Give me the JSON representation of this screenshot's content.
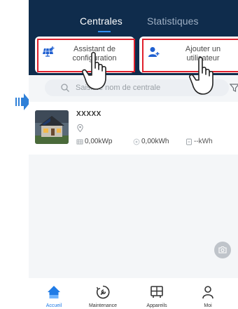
{
  "tabs": {
    "active": "Centrales",
    "inactive": "Statistiques"
  },
  "actions": {
    "assistant": {
      "line1": "Assistant de",
      "line2": "configuration"
    },
    "add_user": {
      "line1": "Ajouter un",
      "line2": "utilisateur"
    }
  },
  "search": {
    "placeholder": "Saisir le nom de centrale"
  },
  "plant": {
    "name": "XXXXX",
    "power": "0,00kWp",
    "energy": "0,00kWh",
    "daily": "--kWh"
  },
  "bottom_nav": {
    "accueil": "Accueil",
    "maintenance": "Maintenance",
    "appareils": "Appareils",
    "moi": "Moi"
  },
  "colors": {
    "header": "#0f2c4c",
    "accent": "#1f7be6",
    "highlight": "#e0202c",
    "arrow": "#2f80d8"
  },
  "icons": [
    "right-arrow-icon",
    "solar-panel-plus-icon",
    "add-user-icon",
    "search-icon",
    "scan-icon",
    "filter-icon",
    "location-pin-icon",
    "panel-icon",
    "energy-icon",
    "battery-icon",
    "camera-icon",
    "home-icon",
    "maintenance-icon",
    "devices-icon",
    "person-icon",
    "pointing-hand-icon"
  ]
}
